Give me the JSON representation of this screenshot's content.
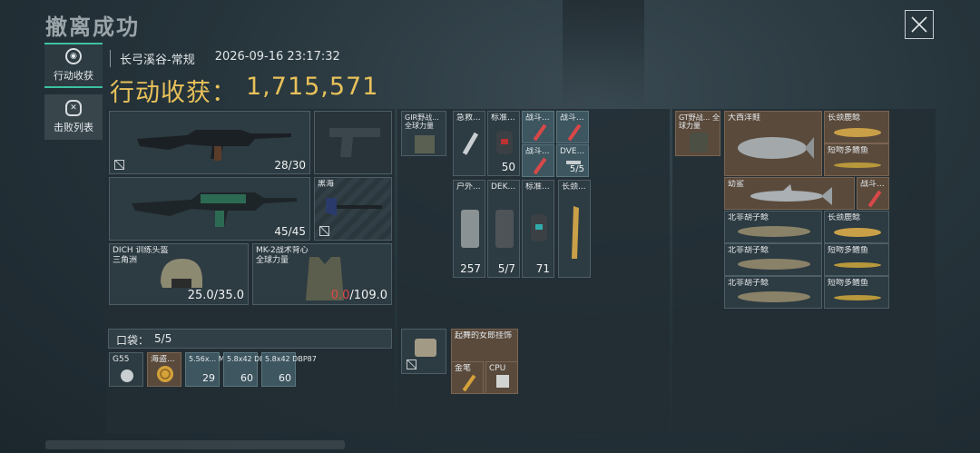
{
  "header": {
    "title": "撤离成功",
    "close_icon": "close-icon"
  },
  "sidebar": {
    "tabs": [
      {
        "label": "行动收获",
        "icon": "target-icon",
        "active": true
      },
      {
        "label": "击败列表",
        "icon": "skull-icon",
        "active": false
      }
    ]
  },
  "meta": {
    "map": "长弓溪谷-常规",
    "datetime": "2026-09-16 23:17:32"
  },
  "earnings": {
    "label": "行动收获：",
    "value": "1,715,571"
  },
  "loadout": {
    "primary": {
      "ammo": "28/30",
      "icon": "rifle-icon"
    },
    "pistol": {
      "icon": "pistol-icon"
    },
    "secondary": {
      "ammo": "45/45",
      "icon": "rifle-icon"
    },
    "melee": {
      "label": "黑海",
      "icon": "axe-icon"
    },
    "helmet": {
      "name": "DICH 训练头盔",
      "origin": "三角洲",
      "durability": "25.0/35.0",
      "icon": "helmet-icon"
    },
    "armor": {
      "name": "MK-2战术背心",
      "origin": "全球力量",
      "durability_current": "0.0",
      "durability_max": "/109.0",
      "icon": "vest-icon"
    },
    "pocket": {
      "label": "口袋：",
      "value": "5/5"
    },
    "pocket_items": [
      {
        "label": "G55",
        "icon": "grenade-icon"
      },
      {
        "label": "海盗...",
        "icon": "coin-icon"
      },
      {
        "label": "5.56x... M855",
        "count": "29",
        "icon": "ammo-icon"
      },
      {
        "label": "5.8x42 DBP87",
        "count": "60",
        "icon": "ammo-icon"
      },
      {
        "label": "5.8x42 DBP87",
        "count": "60",
        "icon": "ammo-icon"
      }
    ]
  },
  "chest_rig": {
    "rig": {
      "label": "GIR野战... 全球力量",
      "icon": "rig-icon"
    },
    "items": [
      {
        "label": "急救...",
        "icon": "syringe-icon"
      },
      {
        "label": "标准...",
        "count": "50",
        "icon": "armor-plate-icon"
      },
      {
        "label": "战斗...",
        "icon": "syringe-icon"
      },
      {
        "label": "战斗...",
        "icon": "syringe-icon"
      },
      {
        "label": "战斗...",
        "icon": "syringe-icon"
      },
      {
        "label": "DVE...",
        "count": "5/5",
        "icon": "tool-icon"
      }
    ],
    "bag_items": [
      {
        "label": "户外...",
        "count": "257",
        "icon": "medkit-icon"
      },
      {
        "label": "DEK...",
        "count": "5/7",
        "icon": "kit-icon"
      },
      {
        "label": "标准...",
        "count": "71",
        "icon": "armor-plate-icon"
      },
      {
        "label": "长颈...",
        "icon": "giraffe-icon"
      }
    ],
    "pouch": {
      "icon": "pouch-icon"
    },
    "charm": {
      "label": "起舞的女郎挂饰",
      "icon": "charm-icon"
    },
    "charm_items": [
      {
        "label": "金笔",
        "icon": "pen-icon"
      },
      {
        "label": "CPU",
        "icon": "cpu-icon"
      }
    ]
  },
  "backpack": {
    "bag": {
      "label": "GT野战... 全球力量",
      "icon": "backpack-icon"
    },
    "fish": [
      {
        "label": "大西洋鲑",
        "icon": "salmon-icon"
      },
      {
        "label": "长颈鹿鲶",
        "icon": "catfish-icon"
      },
      {
        "label": "短吻多鳍鱼",
        "icon": "fish-icon"
      },
      {
        "label": "幼鲨",
        "icon": "shark-icon"
      },
      {
        "label": "战斗...",
        "icon": "syringe-icon"
      },
      {
        "label": "北非胡子鲶",
        "icon": "catfish-icon"
      },
      {
        "label": "长颈鹿鲶",
        "icon": "catfish-icon"
      },
      {
        "label": "北非胡子鲶",
        "icon": "catfish-icon"
      },
      {
        "label": "短吻多鳍鱼",
        "icon": "fish-icon"
      },
      {
        "label": "北非胡子鲶",
        "icon": "catfish-icon"
      },
      {
        "label": "短吻多鳍鱼",
        "icon": "fish-icon"
      }
    ]
  },
  "colors": {
    "accent": "#3dc2a1",
    "gold": "#e8c15a",
    "danger": "#e04848"
  }
}
